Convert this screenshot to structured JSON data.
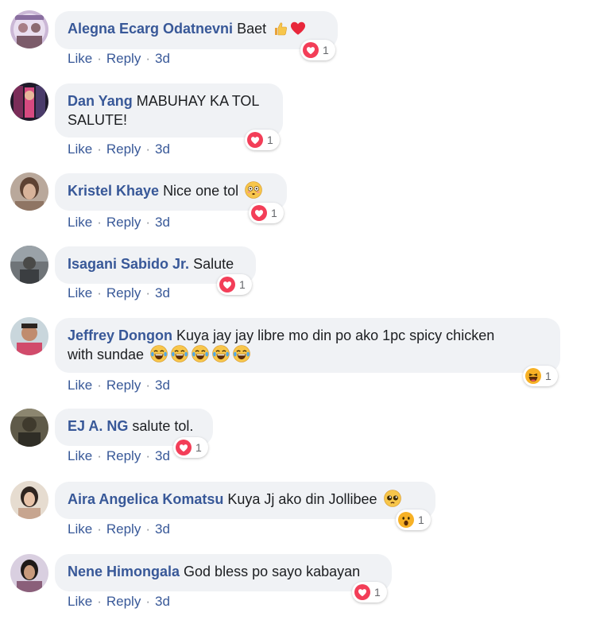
{
  "comments": [
    {
      "author": "Alegna Ecarg Odatnevni",
      "text": "Baet",
      "emojis": [
        "thumbs-up",
        "red-heart"
      ],
      "reaction": "love",
      "reaction_count": "1",
      "like": "Like",
      "reply": "Reply",
      "time": "3d"
    },
    {
      "author": "Dan Yang",
      "text": "MABUHAY KA TOL",
      "text2": "SALUTE!",
      "emojis": [],
      "reaction": "love",
      "reaction_count": "1",
      "like": "Like",
      "reply": "Reply",
      "time": "3d"
    },
    {
      "author": "Kristel Khaye",
      "text": "Nice one tol",
      "emojis": [
        "flushed-face"
      ],
      "reaction": "love",
      "reaction_count": "1",
      "like": "Like",
      "reply": "Reply",
      "time": "3d"
    },
    {
      "author": "Isagani Sabido Jr.",
      "text": "Salute",
      "emojis": [],
      "reaction": "love",
      "reaction_count": "1",
      "like": "Like",
      "reply": "Reply",
      "time": "3d"
    },
    {
      "author": "Jeffrey Dongon",
      "text": "Kuya jay jay libre mo din po ako 1pc spicy chicken",
      "text2": "with sundae",
      "emojis": [
        "crying-laughing",
        "crying-laughing",
        "crying-laughing",
        "crying-laughing",
        "crying-laughing"
      ],
      "reaction": "haha",
      "reaction_count": "1",
      "like": "Like",
      "reply": "Reply",
      "time": "3d"
    },
    {
      "author": "EJ A. NG",
      "text": "salute tol.",
      "emojis": [],
      "reaction": "love",
      "reaction_count": "1",
      "like": "Like",
      "reply": "Reply",
      "time": "3d"
    },
    {
      "author": "Aira Angelica Komatsu",
      "text": "Kuya Jj ako din Jollibee",
      "emojis": [
        "pleading-face"
      ],
      "reaction": "wow",
      "reaction_count": "1",
      "like": "Like",
      "reply": "Reply",
      "time": "3d"
    },
    {
      "author": "Nene Himongala",
      "text": "God bless po sayo kabayan",
      "emojis": [],
      "reaction": "love",
      "reaction_count": "1",
      "like": "Like",
      "reply": "Reply",
      "time": "3d"
    }
  ],
  "colors": {
    "author": "#385898",
    "bubble": "#f0f2f5",
    "love": "#f33e58",
    "haha": "#f7b125"
  }
}
